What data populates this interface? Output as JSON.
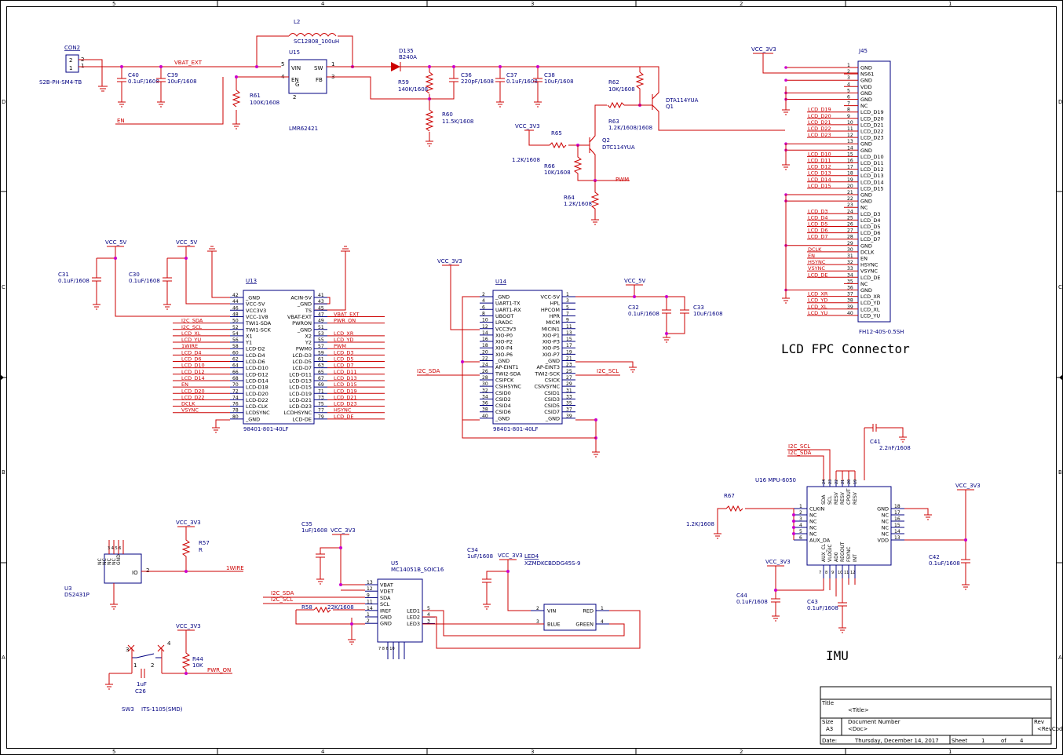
{
  "frame": {
    "col_labels": [
      "5",
      "4",
      "3",
      "2",
      "1"
    ],
    "row_labels": [
      "D",
      "C",
      "B",
      "A"
    ]
  },
  "conn_block": {
    "con_ref": "CON2",
    "con_part": "S2B-PH-SM4-TB",
    "con_pins": [
      "2",
      "1"
    ],
    "c40": [
      "C40",
      "0.1uF/1608"
    ],
    "c39": [
      "C39",
      "10uF/1608"
    ],
    "vbat": "VBAT_EXT",
    "en": "EN",
    "l2": [
      "L2",
      "SC12808_100uH"
    ],
    "u15": {
      "ref": "U15",
      "part": "LMR62421",
      "pins": [
        "VIN",
        "SW",
        "EN",
        "G",
        "FB"
      ],
      "nums": [
        "5",
        "1",
        "4",
        "3",
        "2"
      ]
    },
    "r61": [
      "R61",
      "100K/1608"
    ],
    "d135": [
      "D135",
      "B240A"
    ],
    "r59": [
      "R59",
      "140K/1608"
    ],
    "r60": [
      "R60",
      "11.5K/1608"
    ],
    "c36": [
      "C36",
      "220pF/1608"
    ],
    "c37": [
      "C37",
      "0.1uF/1608"
    ],
    "c38": [
      "C38",
      "10uF/1608"
    ],
    "r62": [
      "R62",
      "10K/1608"
    ],
    "q1": [
      "DTA114YUA",
      "Q1"
    ],
    "r63": [
      "R63",
      "1.2K/1608/1608"
    ],
    "vcc3": "VCC_3V3",
    "r65": [
      "R65",
      "1.2K/1608"
    ],
    "q2": [
      "Q2",
      "DTC114YUA"
    ],
    "r66": [
      "R66",
      "10K/1608"
    ],
    "r64": [
      "R64",
      "1.2K/1608"
    ],
    "pwm": "PWM"
  },
  "lcd_conn": {
    "vcc": "VCC_3V3",
    "ref": "J45",
    "part": "FH12-40S-0.5SH",
    "title": "LCD FPC Connector",
    "pin_names": [
      "GND",
      "NS61",
      "GND",
      "VDD",
      "GND",
      "GND",
      "NC",
      "LCD_D19",
      "LCD_D20",
      "LCD_D21",
      "LCD_D22",
      "LCD_D23",
      "GND",
      "GND",
      "LCD_D10",
      "LCD_D11",
      "LCD_D12",
      "LCD_D13",
      "LCD_D14",
      "LCD_D15",
      "GND",
      "GND",
      "NC",
      "LCD_D3",
      "LCD_D4",
      "LCD_D5",
      "LCD_D6",
      "LCD_D7",
      "GND",
      "DCLK",
      "EN",
      "HSYNC",
      "VSYNC",
      "LCD_DE",
      "NC",
      "GND",
      "LCD_XR",
      "LCD_YD",
      "LCD_XL",
      "LCD_YU"
    ],
    "net_labels": [
      [
        "LCD_D19",
        8
      ],
      [
        "LCD_D20",
        9
      ],
      [
        "LCD_D21",
        10
      ],
      [
        "LCD_D22",
        11
      ],
      [
        "LCD_D23",
        12
      ],
      [
        "LCD_D10",
        15
      ],
      [
        "LCD_D11",
        16
      ],
      [
        "LCD_D12",
        17
      ],
      [
        "LCD_D13",
        18
      ],
      [
        "LCD_D14",
        19
      ],
      [
        "LCD_D15",
        20
      ],
      [
        "LCD_D3",
        24
      ],
      [
        "LCD_D4",
        25
      ],
      [
        "LCD_D5",
        26
      ],
      [
        "LCD_D6",
        27
      ],
      [
        "LCD_D7",
        28
      ],
      [
        "DCLK",
        30
      ],
      [
        "EN",
        31
      ],
      [
        "HSYNC",
        32
      ],
      [
        "VSYNC",
        33
      ],
      [
        "LCD_DE",
        34
      ],
      [
        "LCD_XR",
        37
      ],
      [
        "LCD_YD",
        38
      ],
      [
        "LCD_XL",
        39
      ],
      [
        "LCD_YU",
        40
      ]
    ]
  },
  "u13": {
    "ref": "U13",
    "part": "98401-801-40LF",
    "vcc_a": "VCC_5V",
    "vcc_b": "VCC_5V",
    "c31": [
      "C31",
      "0.1uF/1608"
    ],
    "c30": [
      "C30",
      "0.1uF/1608"
    ],
    "left": [
      [
        "42",
        "_GND",
        ""
      ],
      [
        "44",
        "VCC-5V",
        ""
      ],
      [
        "46",
        "VCC3V3",
        ""
      ],
      [
        "48",
        "VCC-1V8",
        ""
      ],
      [
        "50",
        "TWI1-SDA",
        "I2C_SDA"
      ],
      [
        "52",
        "TWI1-SCK",
        "I2C_SCL"
      ],
      [
        "54",
        "X1",
        "LCD_XL"
      ],
      [
        "56",
        "Y1",
        "LCD_YU"
      ],
      [
        "58",
        "LCD-D2",
        "1WIRE"
      ],
      [
        "60",
        "LCD-D4",
        "LCD_D4"
      ],
      [
        "62",
        "LCD-D6",
        "LCD_D6"
      ],
      [
        "64",
        "LCD-D10",
        "LCD_D10"
      ],
      [
        "66",
        "LCD-D12",
        "LCD_D12"
      ],
      [
        "68",
        "LCD-D14",
        "LCD_D14"
      ],
      [
        "70",
        "LCD-D18",
        "EN"
      ],
      [
        "72",
        "LCD-D20",
        "LCD_D20"
      ],
      [
        "74",
        "LCD-D22",
        "LCD_D22"
      ],
      [
        "76",
        "LCD-CLK",
        "DCLK"
      ],
      [
        "78",
        "LCDSYNC",
        "VSYNC"
      ],
      [
        "80",
        "_GND",
        ""
      ]
    ],
    "right": [
      [
        "41",
        "ACIN-5V",
        ""
      ],
      [
        "43",
        "_GND",
        ""
      ],
      [
        "45",
        "TS",
        ""
      ],
      [
        "47",
        "VBAT-EXT",
        "VBAT_EXT"
      ],
      [
        "49",
        "PWRON",
        "PWR_ON"
      ],
      [
        "51",
        "_GND",
        ""
      ],
      [
        "53",
        "X2",
        "LCD_XR"
      ],
      [
        "55",
        "Y2",
        "LCD_YD"
      ],
      [
        "57",
        "PWM0",
        "PWM"
      ],
      [
        "59",
        "LCD-D3",
        "LCD_D3"
      ],
      [
        "61",
        "LCD-D5",
        "LCD_D5"
      ],
      [
        "63",
        "LCD-D7",
        "LCD_D7"
      ],
      [
        "65",
        "LCD-D11",
        "LCD_D11"
      ],
      [
        "67",
        "LCD-D13",
        "LCD_D13"
      ],
      [
        "69",
        "LCD-D15",
        "LCD_D15"
      ],
      [
        "71",
        "LCD-D19",
        "LCD_D19"
      ],
      [
        "73",
        "LCD-D21",
        "LCD_D21"
      ],
      [
        "75",
        "LCD-D23",
        "LCD_D23"
      ],
      [
        "77",
        "LCDHSYNC",
        "HSYNC"
      ],
      [
        "79",
        "LCD-DE",
        "LCD_DE"
      ]
    ]
  },
  "u14": {
    "ref": "U14",
    "part": "98401-801-40LF",
    "vcc_a": "VCC_3V3",
    "vcc_b": "VCC_5V",
    "c32": [
      "C32",
      "0.1uF/1608"
    ],
    "c33": [
      "C33",
      "10uF/1608"
    ],
    "sda": "I2C_SDA",
    "scl": "I2C_SCL",
    "left": [
      [
        "2",
        "_GND"
      ],
      [
        "4",
        "UART1-TX"
      ],
      [
        "6",
        "UART1-RX"
      ],
      [
        "8",
        "UBOOT"
      ],
      [
        "10",
        "LRADC"
      ],
      [
        "12",
        "VCC3V3"
      ],
      [
        "14",
        "XIO-P0"
      ],
      [
        "16",
        "XIO-P2"
      ],
      [
        "18",
        "XIO-P4"
      ],
      [
        "20",
        "XIO-P6"
      ],
      [
        "22",
        "_GND"
      ],
      [
        "24",
        "AP-EINT1"
      ],
      [
        "26",
        "TWI2-SDA"
      ],
      [
        "28",
        "CSIPCK"
      ],
      [
        "30",
        "CSIHSYNC"
      ],
      [
        "32",
        "CSID0"
      ],
      [
        "34",
        "CSID2"
      ],
      [
        "36",
        "CSID4"
      ],
      [
        "38",
        "CSID6"
      ],
      [
        "40",
        "_GND"
      ]
    ],
    "right": [
      [
        "1",
        "VCC-5V"
      ],
      [
        "3",
        "HPL"
      ],
      [
        "5",
        "HPCOM"
      ],
      [
        "7",
        "HPR"
      ],
      [
        "9",
        "MICM"
      ],
      [
        "11",
        "MICIN1"
      ],
      [
        "13",
        "XIO-P1"
      ],
      [
        "15",
        "XIO-P3"
      ],
      [
        "17",
        "XIO-P5"
      ],
      [
        "19",
        "XIO-P7"
      ],
      [
        "21",
        "_GND"
      ],
      [
        "23",
        "AP-EINT3"
      ],
      [
        "25",
        "TWI2-SCK"
      ],
      [
        "27",
        "CSICK"
      ],
      [
        "29",
        "CSIVSYNC"
      ],
      [
        "31",
        "CSID1"
      ],
      [
        "33",
        "CSID3"
      ],
      [
        "35",
        "CSID5"
      ],
      [
        "37",
        "CSID7"
      ],
      [
        "39",
        "_GND"
      ]
    ]
  },
  "imu": {
    "title": "IMU",
    "ref": "U16 MPU-6050",
    "scl": "I2C_SCL",
    "sda": "I2C_SDA",
    "c41": [
      "C41",
      "2.2nF/1608"
    ],
    "r67": [
      "R67",
      "1.2K/1608"
    ],
    "vcc_r": "VCC_3V3",
    "vcc_l": "VCC_3V3",
    "c42": [
      "C42",
      "0.1uF/1608"
    ],
    "c44": [
      "C44",
      "0.1uF/1608"
    ],
    "c43": [
      "C43",
      "0.1uF/1608"
    ],
    "left_pins": [
      [
        "1",
        "CLKIN"
      ],
      [
        "2",
        "NC"
      ],
      [
        "3",
        "NC"
      ],
      [
        "4",
        "NC"
      ],
      [
        "5",
        "NC"
      ],
      [
        "6",
        "AUX_DA"
      ]
    ],
    "right_pins": [
      [
        "18",
        "GND"
      ],
      [
        "17",
        "NC"
      ],
      [
        "16",
        "NC"
      ],
      [
        "15",
        "NC"
      ],
      [
        "14",
        "NC"
      ],
      [
        "13",
        "VDD"
      ]
    ],
    "top_pins": [
      "SDA",
      "SCL",
      "RESV",
      "RESV",
      "CPOUT",
      "RESV"
    ],
    "top_nums": [
      "24",
      "23",
      "22",
      "21",
      "20",
      "19"
    ],
    "bottom_pins": [
      "AUX_CL",
      "VLOGIC",
      "AD0",
      "REGOUT",
      "FSYNC",
      "INT"
    ],
    "bottom_nums": [
      "7",
      "8",
      "9",
      "10",
      "11",
      "12"
    ]
  },
  "ds": {
    "vcc": "VCC_3V3",
    "r57": [
      "R57",
      "R"
    ],
    "ref": "U3",
    "part": "DS2431P",
    "pins": [
      "NC",
      "NC",
      "NC",
      "NC",
      "GND"
    ],
    "io": "IO",
    "io_num": "2",
    "net": "1WIRE"
  },
  "sw": {
    "vcc": "VCC_3V3",
    "r44": [
      "R44",
      "10K"
    ],
    "net": "PWR_ON",
    "c26": [
      "C26",
      "1uF"
    ],
    "ref": "SW3",
    "part": "ITS-1105(SMD)",
    "pins": [
      "1",
      "2",
      "3",
      "4"
    ]
  },
  "led": {
    "c35": [
      "C35",
      "1uF/1608"
    ],
    "vcc1": "VCC_3V3",
    "u5": [
      "U5",
      "MC14051B_SOIC16"
    ],
    "sda": "I2C_SDA",
    "scl": "I2C_SCL",
    "r58": [
      "R58",
      "22K/1608"
    ],
    "u5_left": [
      [
        "13",
        "VBAT"
      ],
      [
        "12",
        "VDET"
      ],
      [
        "9",
        "SDA"
      ],
      [
        "11",
        "SCL"
      ],
      [
        "14",
        "IREF"
      ],
      [
        "1",
        "GND"
      ],
      [
        "2",
        "GND"
      ]
    ],
    "u5_right": [
      [
        "5",
        "LED1"
      ],
      [
        "4",
        "LED2"
      ],
      [
        "3",
        "LED3"
      ]
    ],
    "c34": [
      "C34",
      "1uF/1608"
    ],
    "vcc2": "VCC_3V3",
    "led4": [
      "LED4",
      "XZMDKCBDDG45S-9"
    ],
    "led_pins": [
      [
        "2",
        "VIN",
        "RED",
        "1"
      ],
      [
        "3",
        "BLUE",
        "GREEN",
        "4"
      ]
    ]
  },
  "title_block": {
    "title_label": "Title",
    "title_value": "<Title>",
    "size_label": "Size",
    "size_value": "A3",
    "doc_label": "Document Number",
    "doc_value": "<Doc>",
    "rev_label": "Rev",
    "rev_value": "<RevCod",
    "date_label": "Date:",
    "date_value": "Thursday, December 14, 2017",
    "sheet_label": "Sheet",
    "sheet_num": "1",
    "of_label": "of",
    "sheet_total": "4"
  }
}
